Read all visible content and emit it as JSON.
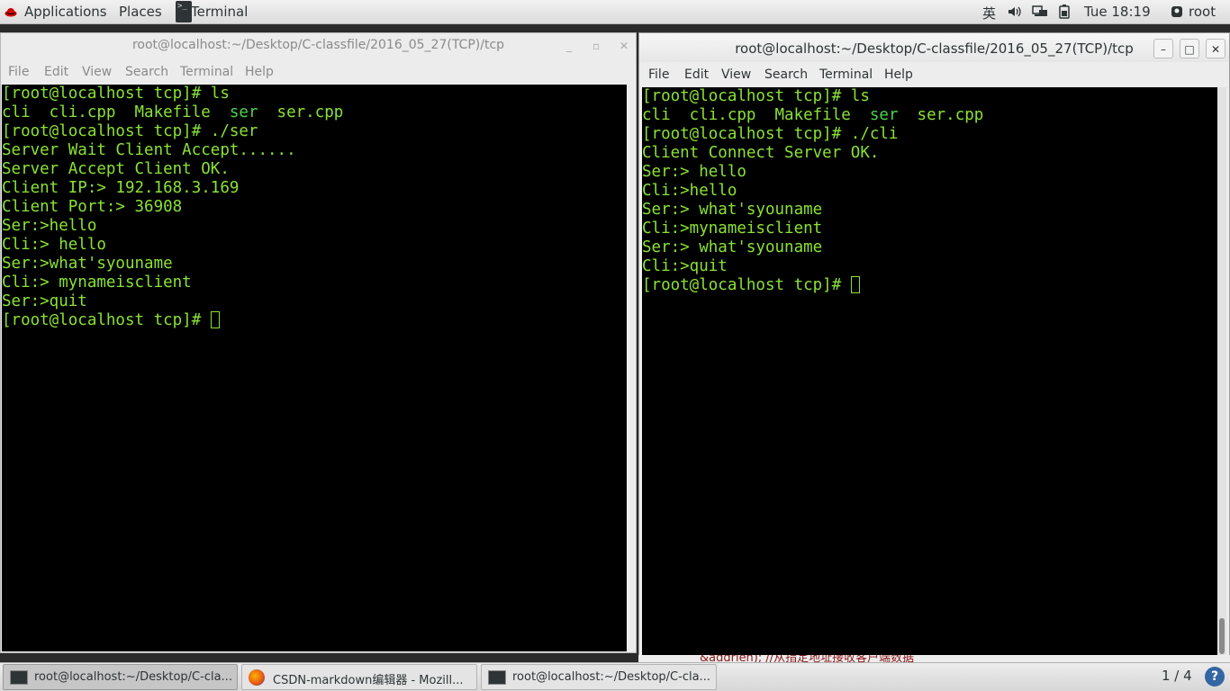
{
  "top_panel": {
    "applications": "Applications",
    "places": "Places",
    "active_app": "Terminal",
    "input_method": "英",
    "clock": "Tue 18:19",
    "user": "root"
  },
  "left_window": {
    "title": "root@localhost:~/Desktop/C-classfile/2016_05_27(TCP)/tcp",
    "menu": [
      "File",
      "Edit",
      "View",
      "Search",
      "Terminal",
      "Help"
    ],
    "lines": [
      {
        "t": "[root@localhost tcp]# ls"
      },
      {
        "segs": [
          {
            "t": "cli",
            "c": "#8ae234"
          },
          {
            "t": "  cli.cpp  Makefile  ",
            "c": "#8ae234"
          },
          {
            "t": "ser",
            "c": "#4cd24c"
          },
          {
            "t": "  ser.cpp",
            "c": "#8ae234"
          }
        ]
      },
      {
        "t": "[root@localhost tcp]# ./ser"
      },
      {
        "t": "Server Wait Client Accept......"
      },
      {
        "t": "Server Accept Client OK."
      },
      {
        "t": "Client IP:> 192.168.3.169"
      },
      {
        "t": "Client Port:> 36908"
      },
      {
        "t": "Ser:>hello"
      },
      {
        "t": "Cli:> hello"
      },
      {
        "t": "Ser:>what'syouname"
      },
      {
        "t": "Cli:> mynameisclient"
      },
      {
        "t": "Ser:>quit"
      },
      {
        "t": "[root@localhost tcp]# ",
        "cursor": true
      }
    ]
  },
  "right_window": {
    "title": "root@localhost:~/Desktop/C-classfile/2016_05_27(TCP)/tcp",
    "menu": [
      "File",
      "Edit",
      "View",
      "Search",
      "Terminal",
      "Help"
    ],
    "lines": [
      {
        "t": "[root@localhost tcp]# ls"
      },
      {
        "segs": [
          {
            "t": "cli",
            "c": "#8ae234"
          },
          {
            "t": "  cli.cpp  Makefile  ",
            "c": "#8ae234"
          },
          {
            "t": "ser",
            "c": "#4cd24c"
          },
          {
            "t": "  ser.cpp",
            "c": "#8ae234"
          }
        ]
      },
      {
        "t": "[root@localhost tcp]# ./cli"
      },
      {
        "t": "Client Connect Server OK."
      },
      {
        "t": "Ser:> hello"
      },
      {
        "t": "Cli:>hello"
      },
      {
        "t": "Ser:> what'syouname"
      },
      {
        "t": "Cli:>mynameisclient"
      },
      {
        "t": "Ser:> what'syouname"
      },
      {
        "t": "Cli:>quit"
      },
      {
        "t": "[root@localhost tcp]# ",
        "cursor": true
      }
    ]
  },
  "background_window_peek": "&addrlen);      //从指定地址接收客户端数据",
  "taskbar": {
    "tasks": [
      {
        "label": "root@localhost:~/Desktop/C-cla...",
        "icon": "terminal-icon",
        "active": true
      },
      {
        "label": "CSDN-markdown编辑器 - Mozill...",
        "icon": "firefox-icon",
        "active": false
      },
      {
        "label": "root@localhost:~/Desktop/C-cla...",
        "icon": "terminal-icon",
        "active": false
      }
    ],
    "workspace": "1 / 4",
    "help": "?"
  },
  "colors": {
    "terminal_bg": "#000000",
    "terminal_fg": "#8ae234",
    "executable": "#4cd24c"
  }
}
